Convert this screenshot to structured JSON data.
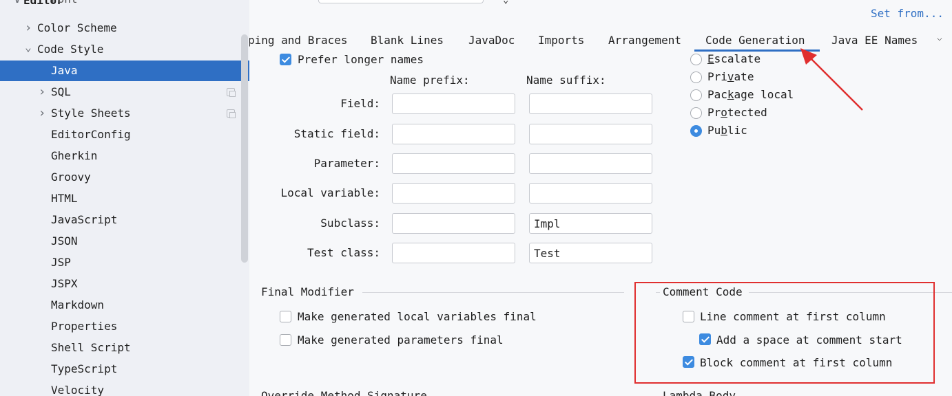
{
  "sidebar": {
    "top_clipped": "Editor",
    "items": [
      {
        "label": "Font",
        "chevron": "",
        "indent": 2,
        "clipped": true
      },
      {
        "label": "Color Scheme",
        "chevron": ">",
        "indent": 1
      },
      {
        "label": "Code Style",
        "chevron": "v",
        "indent": 1
      },
      {
        "label": "Java",
        "chevron": "",
        "indent": 2,
        "selected": true
      },
      {
        "label": "SQL",
        "chevron": ">",
        "indent": 2,
        "copy_icon": true
      },
      {
        "label": "Style Sheets",
        "chevron": ">",
        "indent": 2,
        "copy_icon": true
      },
      {
        "label": "EditorConfig",
        "chevron": "",
        "indent": 2
      },
      {
        "label": "Gherkin",
        "chevron": "",
        "indent": 2
      },
      {
        "label": "Groovy",
        "chevron": "",
        "indent": 2
      },
      {
        "label": "HTML",
        "chevron": "",
        "indent": 2
      },
      {
        "label": "JavaScript",
        "chevron": "",
        "indent": 2
      },
      {
        "label": "JSON",
        "chevron": "",
        "indent": 2
      },
      {
        "label": "JSP",
        "chevron": "",
        "indent": 2
      },
      {
        "label": "JSPX",
        "chevron": "",
        "indent": 2
      },
      {
        "label": "Markdown",
        "chevron": "",
        "indent": 2
      },
      {
        "label": "Properties",
        "chevron": "",
        "indent": 2
      },
      {
        "label": "Shell Script",
        "chevron": "",
        "indent": 2
      },
      {
        "label": "TypeScript",
        "chevron": "",
        "indent": 2
      },
      {
        "label": "Velocity",
        "chevron": "",
        "indent": 2
      }
    ]
  },
  "header": {
    "set_from": "Set from..."
  },
  "tabs": [
    {
      "label": "ping and Braces"
    },
    {
      "label": "Blank Lines"
    },
    {
      "label": "JavaDoc"
    },
    {
      "label": "Imports"
    },
    {
      "label": "Arrangement"
    },
    {
      "label": "Code Generation",
      "active": true
    },
    {
      "label": "Java EE Names"
    }
  ],
  "naming": {
    "prefer_longer_names": "Prefer longer names",
    "prefer_longer_checked": true,
    "prefix_header": "Name prefix:",
    "suffix_header": "Name suffix:",
    "rows": [
      {
        "label": "Field:",
        "prefix": "",
        "suffix": ""
      },
      {
        "label": "Static field:",
        "prefix": "",
        "suffix": ""
      },
      {
        "label": "Parameter:",
        "prefix": "",
        "suffix": ""
      },
      {
        "label": "Local variable:",
        "prefix": "",
        "suffix": ""
      },
      {
        "label": "Subclass:",
        "prefix": "",
        "suffix": "Impl"
      },
      {
        "label": "Test class:",
        "prefix": "",
        "suffix": "Test"
      }
    ]
  },
  "visibility": {
    "options": [
      {
        "pre": "",
        "mn": "E",
        "post": "scalate",
        "selected": false
      },
      {
        "pre": "Pri",
        "mn": "v",
        "post": "ate",
        "selected": false
      },
      {
        "pre": "Pac",
        "mn": "k",
        "post": "age local",
        "selected": false
      },
      {
        "pre": "Pr",
        "mn": "o",
        "post": "tected",
        "selected": false
      },
      {
        "pre": "Pu",
        "mn": "b",
        "post": "lic",
        "selected": true
      }
    ]
  },
  "final_modifier": {
    "title": "Final Modifier",
    "local_vars": "Make generated local variables final",
    "local_vars_checked": false,
    "params": "Make generated parameters final",
    "params_checked": false
  },
  "comment_code": {
    "title": "Comment Code",
    "line_first_col": "Line comment at first column",
    "line_first_col_checked": false,
    "add_space": "Add a space at comment start",
    "add_space_checked": true,
    "block_first_col": "Block comment at first column",
    "block_first_col_checked": true
  },
  "bottom_clipped": {
    "left": "Override Method Signature",
    "right": "Lambda Body"
  },
  "colors": {
    "accent": "#2f6fc4",
    "annotation_red": "#e02f2f"
  }
}
